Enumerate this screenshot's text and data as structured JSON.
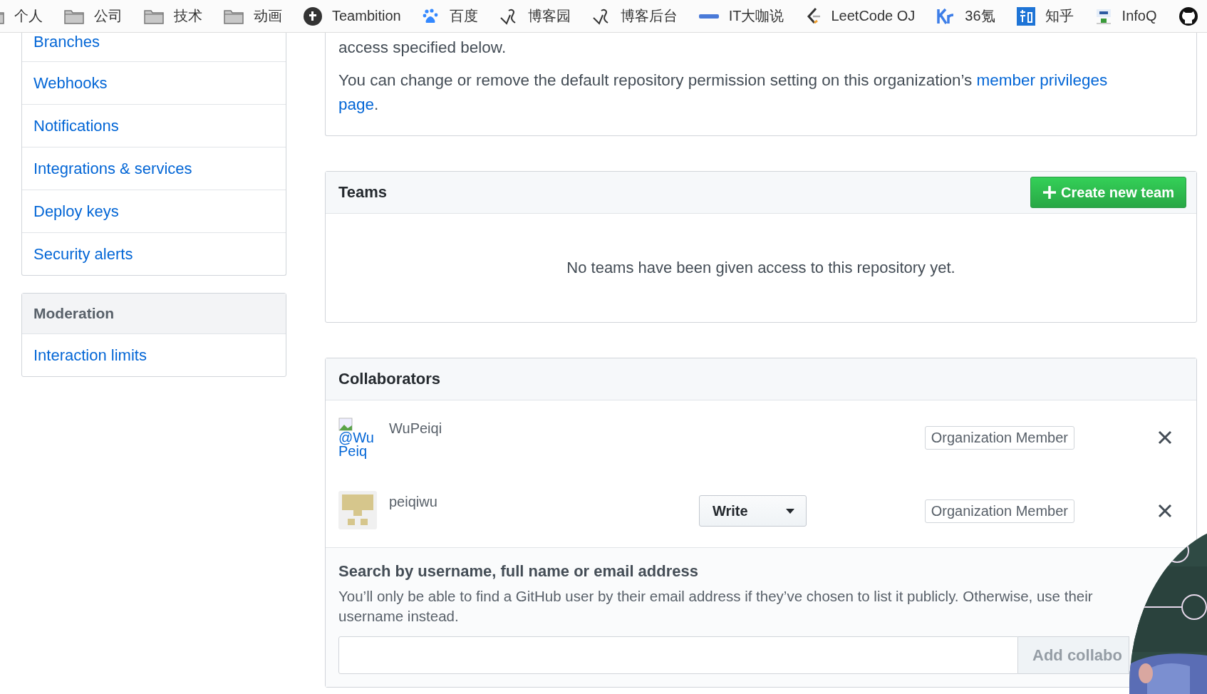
{
  "bookmarks": [
    {
      "kind": "folder",
      "label": "个人"
    },
    {
      "kind": "folder",
      "label": "公司"
    },
    {
      "kind": "folder",
      "label": "技术"
    },
    {
      "kind": "folder",
      "label": "动画"
    },
    {
      "kind": "teambition",
      "label": "Teambition"
    },
    {
      "kind": "baidu",
      "label": "百度"
    },
    {
      "kind": "cnblogs",
      "label": "博客园"
    },
    {
      "kind": "cnblogs",
      "label": "博客后台"
    },
    {
      "kind": "itdks",
      "label": "IT大咖说"
    },
    {
      "kind": "leetcode",
      "label": "LeetCode OJ"
    },
    {
      "kind": "kr",
      "label": "36氪"
    },
    {
      "kind": "zhihu",
      "label": "知乎"
    },
    {
      "kind": "infoq",
      "label": "InfoQ"
    },
    {
      "kind": "github"
    }
  ],
  "sidebar": {
    "groups": [
      {
        "items": [
          "Branches",
          "Webhooks",
          "Notifications",
          "Integrations & services",
          "Deploy keys",
          "Security alerts"
        ]
      },
      {
        "header": "Moderation",
        "items": [
          "Interaction limits"
        ]
      }
    ]
  },
  "permissions_notice": {
    "lead": "access specified below.",
    "text": "You can change or remove the default repository permission setting on this organization’s ",
    "link": [
      "member privileges",
      "page"
    ],
    "end": "."
  },
  "teams": {
    "title": "Teams",
    "button": "Create new team",
    "empty": "No teams have been given access to this repository yet."
  },
  "collaborators": {
    "title": "Collaborators",
    "rows": [
      {
        "kind": "broken",
        "alt": "@WuPeiq",
        "name": "WuPeiqi",
        "role": "Organization Member"
      },
      {
        "kind": "identicon",
        "name": "peiqiwu",
        "permission": "Write",
        "role": "Organization Member"
      }
    ],
    "search": {
      "title": "Search by username, full name or email address",
      "description": [
        "You’ll only be able to find a GitHub user by their email address if they’ve chosen to list it publicly. Otherwise, use their",
        "username instead."
      ],
      "button": "Add collabo"
    }
  }
}
